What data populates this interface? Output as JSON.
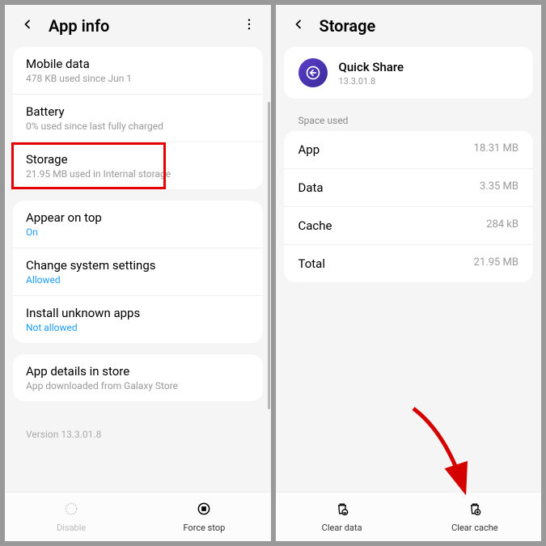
{
  "left": {
    "title": "App info",
    "rows": {
      "mobile_data": {
        "title": "Mobile data",
        "sub": "478 KB used since Jun 1"
      },
      "battery": {
        "title": "Battery",
        "sub": "0% used since last fully charged"
      },
      "storage": {
        "title": "Storage",
        "sub": "21.95 MB used in Internal storage"
      },
      "appear_on_top": {
        "title": "Appear on top",
        "sub": "On"
      },
      "change_sys": {
        "title": "Change system settings",
        "sub": "Allowed"
      },
      "install_unknown": {
        "title": "Install unknown apps",
        "sub": "Not allowed"
      },
      "app_details": {
        "title": "App details in store",
        "sub": "App downloaded from Galaxy Store"
      }
    },
    "version": "Version 13.3.01.8",
    "buttons": {
      "disable": "Disable",
      "force_stop": "Force stop"
    }
  },
  "right": {
    "title": "Storage",
    "app": {
      "name": "Quick Share",
      "version": "13.3.01.8"
    },
    "section_label": "Space used",
    "data": {
      "app": {
        "label": "App",
        "value": "18.31 MB"
      },
      "data": {
        "label": "Data",
        "value": "3.35 MB"
      },
      "cache": {
        "label": "Cache",
        "value": "284 kB"
      },
      "total": {
        "label": "Total",
        "value": "21.95 MB"
      }
    },
    "buttons": {
      "clear_data": "Clear data",
      "clear_cache": "Clear cache"
    }
  }
}
